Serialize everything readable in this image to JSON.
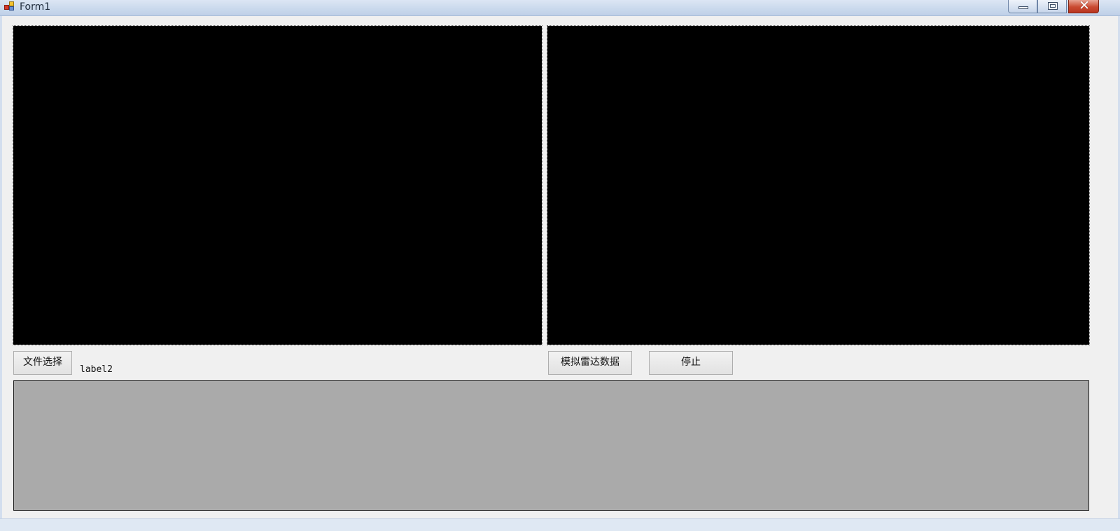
{
  "window": {
    "title": "Form1",
    "controls": {
      "minimize": "minimize-icon",
      "maximize": "maximize-icon",
      "close": "close-icon",
      "close_glyph": "✕"
    }
  },
  "toolbar": {
    "file_select_label": "文件选择",
    "label2_text": "label2",
    "simulate_radar_label": "模拟雷达数据",
    "stop_label": "停止"
  },
  "colors": {
    "video_background": "#000000",
    "bottom_panel_background": "#aaaaaa",
    "form_background": "#f0f0f0"
  }
}
